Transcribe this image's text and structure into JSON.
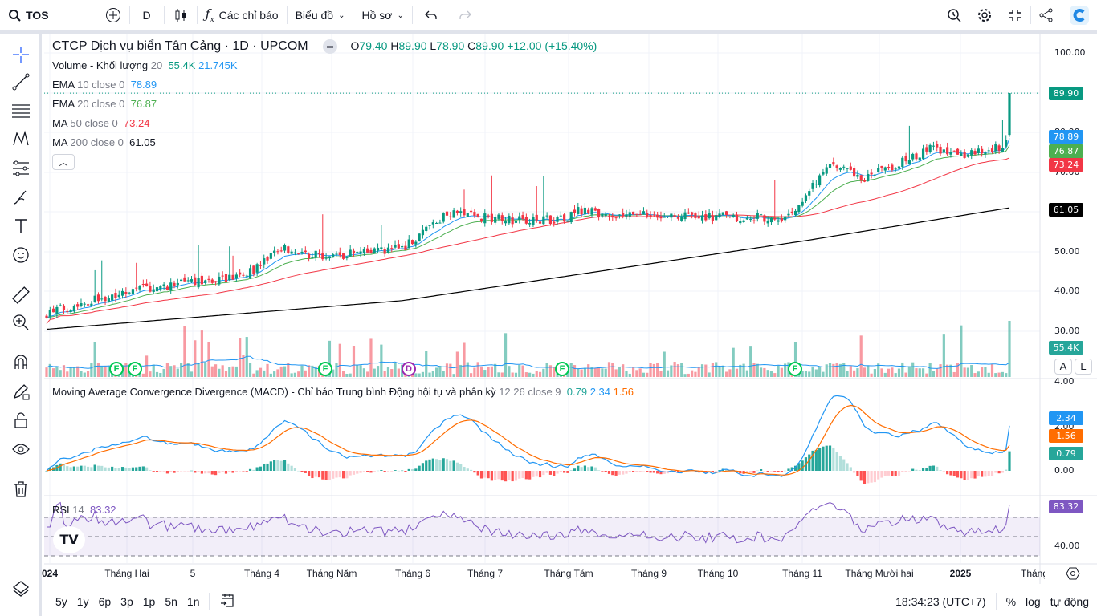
{
  "topbar": {
    "symbol": "TOS",
    "interval": "D",
    "indicators_label": "Các chỉ báo",
    "chart_label": "Biểu đồ",
    "profile_label": "Hồ sơ"
  },
  "legend": {
    "title": "CTCP Dịch vụ biển Tân Cảng · 1D · UPCOM",
    "o_label": "O",
    "o": "79.40",
    "h_label": "H",
    "h": "89.90",
    "l_label": "L",
    "l": "78.90",
    "c_label": "C",
    "c": "89.90",
    "change": "+12.00 (+15.40%)",
    "volume": {
      "name": "Volume - Khối lượng",
      "param": "20",
      "v1": "55.4K",
      "v2": "21.745K"
    },
    "ema10": {
      "name": "EMA",
      "param": "10 close 0",
      "value": "78.89"
    },
    "ema20": {
      "name": "EMA",
      "param": "20 close 0",
      "value": "76.87"
    },
    "ma50": {
      "name": "MA",
      "param": "50 close 0",
      "value": "73.24"
    },
    "ma200": {
      "name": "MA",
      "param": "200 close 0",
      "value": "61.05"
    },
    "macd": {
      "name": "Moving Average Convergence Divergence (MACD) - Chỉ báo Trung bình Động hội tụ và phân kỳ",
      "param": "12 26 close 9",
      "hist": "0.79",
      "macd": "2.34",
      "signal": "1.56"
    },
    "rsi": {
      "name": "RSI",
      "param": "14",
      "value": "83.32"
    }
  },
  "price_axis": [
    "100.00",
    "80.00",
    "70.00",
    "50.00",
    "40.00",
    "30.00"
  ],
  "price_labels": {
    "last": "89.90",
    "ema10": "78.89",
    "ema20": "76.87",
    "ma50": "73.24",
    "ma200": "61.05",
    "volume": "55.4K"
  },
  "macd_axis": [
    "4.00",
    "2.00",
    "0.00"
  ],
  "macd_labels": {
    "macd": "2.34",
    "signal": "1.56",
    "hist": "0.79"
  },
  "rsi_axis": [
    "40.00"
  ],
  "rsi_label": "83.32",
  "scale_buttons": {
    "a": "A",
    "l": "L"
  },
  "time_axis": [
    "024",
    "Tháng Hai",
    "5",
    "Tháng 4",
    "Tháng Năm",
    "Tháng 6",
    "Tháng 7",
    "Tháng Tám",
    "Tháng 9",
    "Tháng 10",
    "Tháng 11",
    "Tháng Mười hai",
    "2025",
    "Tháng I"
  ],
  "events": [
    "F",
    "F",
    "F",
    "D",
    "F",
    "F"
  ],
  "ranges": [
    "5y",
    "1y",
    "6p",
    "3p",
    "1p",
    "5n",
    "1n"
  ],
  "bottom": {
    "clock": "18:34:23 (UTC+7)",
    "percent": "%",
    "log": "log",
    "auto": "tự động"
  },
  "colors": {
    "up": "#089981",
    "down": "#f23645",
    "ema10": "#2196f3",
    "ema20": "#4caf50",
    "ma50": "#f23645",
    "ma200": "#000000",
    "macd": "#2196f3",
    "signal": "#ff6d00",
    "rsi": "#7e57c2"
  },
  "chart_data": {
    "type": "candlestick",
    "bars": 280,
    "close_anchors": [
      [
        0,
        34.6
      ],
      [
        25,
        40.7
      ],
      [
        37,
        41.7
      ],
      [
        57,
        43.7
      ],
      [
        68,
        50.8
      ],
      [
        80,
        48.8
      ],
      [
        103,
        50.8
      ],
      [
        110,
        55.8
      ],
      [
        117,
        59.9
      ],
      [
        127,
        58.8
      ],
      [
        138,
        57.8
      ],
      [
        150,
        58.4
      ],
      [
        155,
        60.5
      ],
      [
        164,
        59.2
      ],
      [
        173,
        59.2
      ],
      [
        197,
        58.8
      ],
      [
        215,
        58.4
      ],
      [
        220,
        63.9
      ],
      [
        227,
        72
      ],
      [
        236,
        68.5
      ],
      [
        243,
        70.5
      ],
      [
        257,
        76.6
      ],
      [
        264,
        74
      ],
      [
        276,
        76
      ],
      [
        278,
        77.9
      ]
    ],
    "last_bar": {
      "open": 79.4,
      "high": 89.9,
      "low": 78.9,
      "close": 89.9,
      "volume": 55.4
    },
    "ma200_anchors": [
      [
        0,
        30.5
      ],
      [
        103,
        37.7
      ],
      [
        220,
        52.8
      ],
      [
        279,
        61.05
      ]
    ],
    "ylim": [
      30,
      100
    ]
  }
}
